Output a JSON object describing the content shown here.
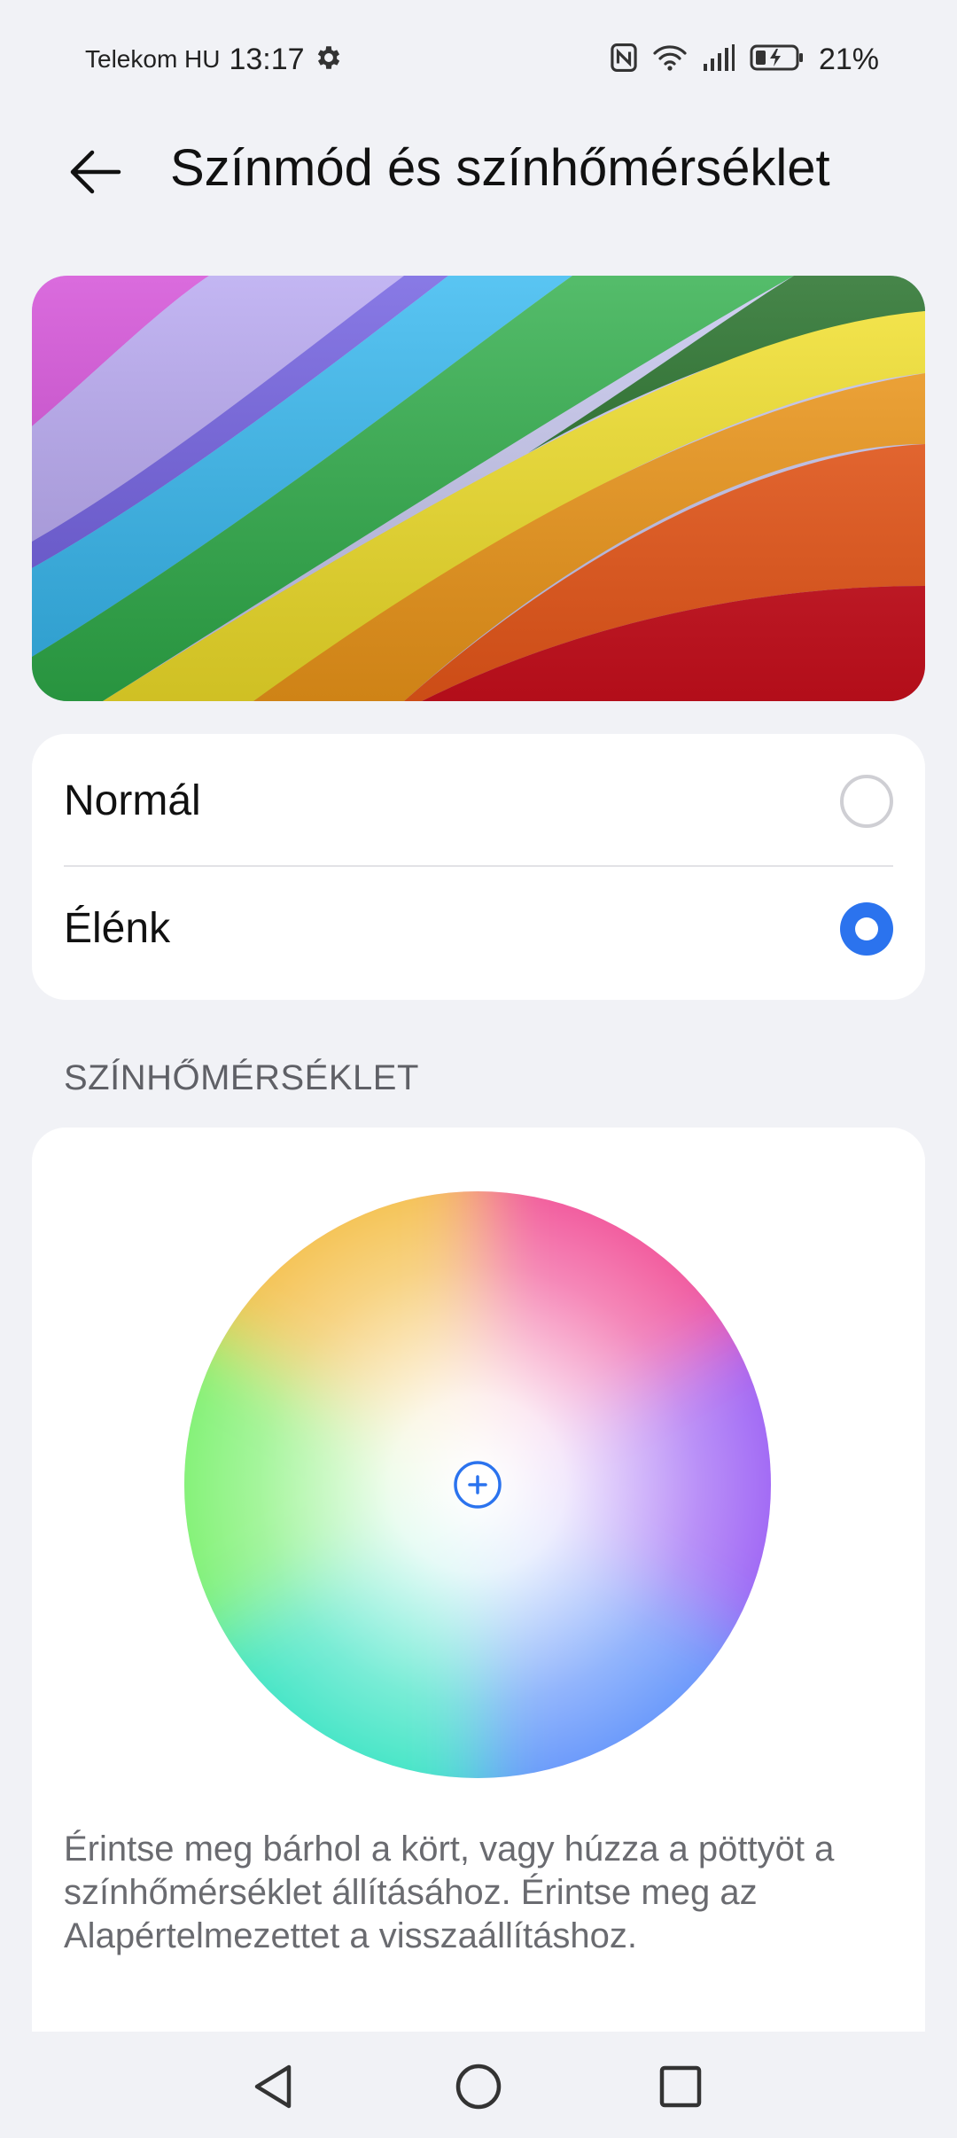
{
  "status_bar": {
    "carrier": "Telekom HU",
    "time": "13:17",
    "battery_percent": "21%",
    "icons": [
      "settings-gear-icon",
      "nfc-icon",
      "wifi-icon",
      "cellular-signal-icon",
      "battery-charging-icon"
    ]
  },
  "header": {
    "title": "Színmód és színhőmérséklet",
    "back_icon": "arrow-left-icon"
  },
  "color_mode": {
    "options": [
      {
        "label": "Normál",
        "selected": false
      },
      {
        "label": "Élénk",
        "selected": true
      }
    ],
    "accent_color": "#2b73ee"
  },
  "color_temperature": {
    "section_title": "SZÍNHŐMÉRSÉKLET",
    "wheel_center_icon": "plus-target-icon",
    "help_text": "Érintse meg bárhol a kört, vagy húzza a pöttyöt a színhőmérséklet állításához. Érintse meg az Alapértelmezettet a visszaállításhoz."
  },
  "nav_bar": {
    "icons": [
      "back-triangle-icon",
      "home-circle-icon",
      "recents-square-icon"
    ]
  }
}
